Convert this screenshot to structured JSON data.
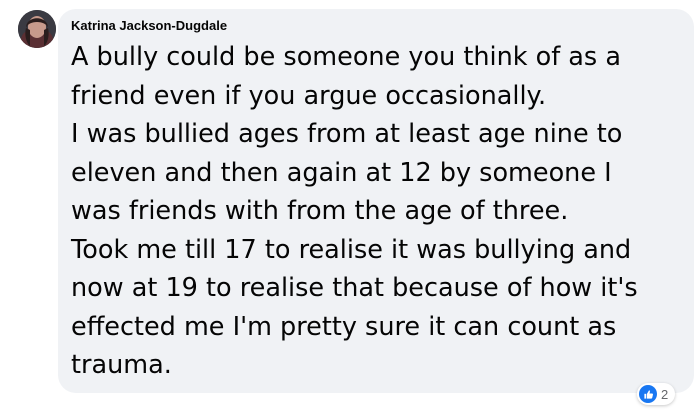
{
  "comment": {
    "author": "Katrina Jackson-Dugdale",
    "lines": [
      "A bully could be someone you think of as a",
      "friend even if you argue occasionally.",
      "I was bullied ages from at least age nine to",
      "eleven and then again at 12 by someone I",
      "was friends with from the age of three.",
      "Took me till 17 to realise it was bullying and",
      "now at 19 to realise that because of how it's",
      "effected me I'm pretty sure it can count as",
      "trauma."
    ],
    "reactions": {
      "icon": "like-icon",
      "count": "2",
      "color": "#1877f2"
    }
  },
  "colors": {
    "bubble": "#f0f2f5",
    "text": "#050505",
    "muted": "#65676b"
  }
}
